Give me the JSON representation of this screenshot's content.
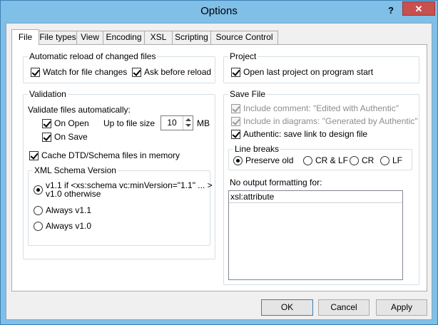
{
  "window": {
    "title": "Options",
    "help": "?",
    "close": "✕"
  },
  "tabs": [
    "File",
    "File types",
    "View",
    "Encoding",
    "XSL",
    "Scripting",
    "Source Control"
  ],
  "reload": {
    "title": "Automatic reload of changed files",
    "watch": "Watch for file changes",
    "ask": "Ask before reload"
  },
  "validation": {
    "title": "Validation",
    "auto": "Validate files automatically:",
    "on_open": "On Open",
    "on_save": "On Save",
    "size_label": "Up to file size",
    "size_value": "10",
    "size_unit": "MB",
    "cache": "Cache DTD/Schema files in memory",
    "xsv": {
      "title": "XML Schema Version",
      "opt1_line1": "v1.1 if <xs:schema vc:minVersion=\"1.1\" ... >",
      "opt1_line2": "v1.0 otherwise",
      "opt2": "Always v1.1",
      "opt3": "Always v1.0"
    }
  },
  "project": {
    "title": "Project",
    "open_last": "Open last project on program start"
  },
  "save": {
    "title": "Save File",
    "comment": "Include comment: \"Edited with Authentic\"",
    "diagrams": "Include in diagrams: \"Generated by Authentic\"",
    "authentic": "Authentic: save link to design file",
    "line_breaks": {
      "title": "Line breaks",
      "preserve": "Preserve old",
      "crlf": "CR & LF",
      "cr": "CR",
      "lf": "LF"
    },
    "no_format_label": "No output formatting for:",
    "no_format_items": [
      "xsl:attribute"
    ]
  },
  "buttons": {
    "ok": "OK",
    "cancel": "Cancel",
    "apply": "Apply"
  }
}
